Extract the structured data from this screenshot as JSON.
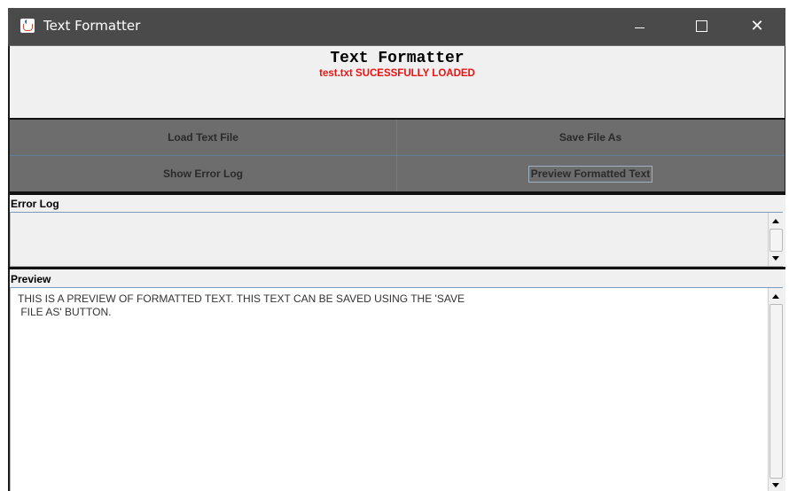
{
  "window": {
    "title": "Text Formatter",
    "icon": "java-cup-icon",
    "controls": {
      "minimize": "minimize-icon",
      "maximize": "maximize-icon",
      "close_glyph": "✕"
    }
  },
  "header": {
    "title": "Text Formatter",
    "status": "test.txt SUCESSFULLY LOADED",
    "status_color": "#ee1111"
  },
  "buttons": {
    "load": "Load Text File",
    "save_as": "Save File As",
    "show_error_log": "Show  Error Log",
    "preview": "Preview Formatted Text"
  },
  "error_log": {
    "label": "Error Log",
    "content": ""
  },
  "preview": {
    "label": "Preview",
    "content": "THIS IS A PREVIEW OF FORMATTED TEXT. THIS TEXT CAN BE SAVED USING THE 'SAVE\n FILE AS' BUTTON."
  },
  "colors": {
    "titlebar": "#4a4a4a",
    "button_panel": "#6d6d6d",
    "panel_bg": "#f0f0f0"
  }
}
